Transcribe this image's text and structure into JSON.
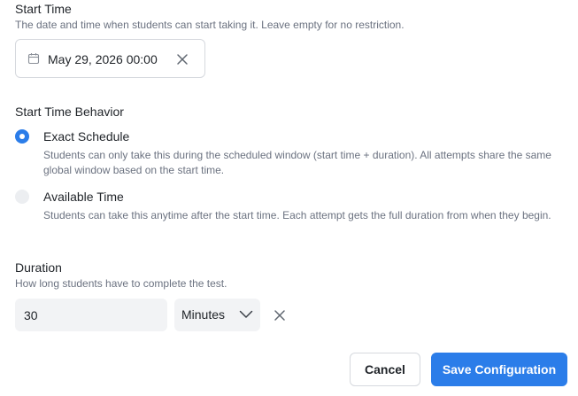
{
  "start_time": {
    "title": "Start Time",
    "helper": "The date and time when students can start taking it. Leave empty for no restriction.",
    "value": "May 29, 2026 00:00",
    "icon": "calendar-icon",
    "clear_icon": "close-icon"
  },
  "behavior": {
    "title": "Start Time Behavior",
    "options": [
      {
        "label": "Exact Schedule",
        "description": "Students can only take this during the scheduled window (start time + duration). All attempts share the same global window based on the start time.",
        "selected": true
      },
      {
        "label": "Available Time",
        "description": "Students can take this anytime after the start time. Each attempt gets the full duration from when they begin.",
        "selected": false
      }
    ]
  },
  "duration": {
    "title": "Duration",
    "helper": "How long students have to complete the test.",
    "value": "30",
    "unit": "Minutes",
    "clear_icon": "close-icon"
  },
  "actions": {
    "cancel_label": "Cancel",
    "save_label": "Save Configuration"
  },
  "colors": {
    "accent": "#2b7de9",
    "muted_text": "#6b7280",
    "input_bg": "#f2f3f5"
  }
}
